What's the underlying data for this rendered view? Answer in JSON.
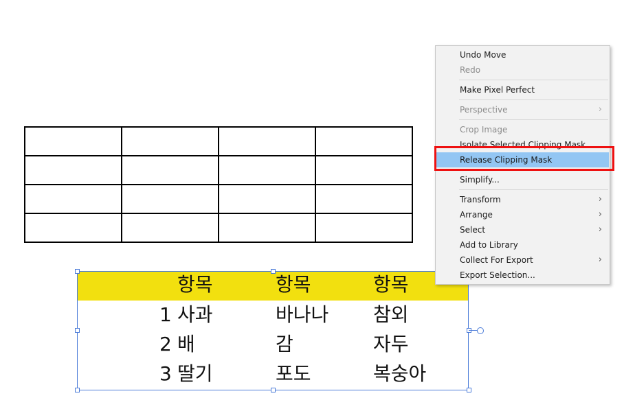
{
  "context_menu": {
    "items": [
      {
        "label": "Undo Move",
        "disabled": false
      },
      {
        "label": "Redo",
        "disabled": true
      },
      {
        "label": "Make Pixel Perfect",
        "disabled": false
      },
      {
        "label": "Perspective",
        "disabled": true,
        "submenu": true
      },
      {
        "label": "Crop Image",
        "disabled": true
      },
      {
        "label": "Isolate Selected Clipping Mask",
        "disabled": false
      },
      {
        "label": "Release Clipping Mask",
        "disabled": false,
        "highlighted": true
      },
      {
        "label": "Simplify...",
        "disabled": false
      },
      {
        "label": "Transform",
        "disabled": false,
        "submenu": true
      },
      {
        "label": "Arrange",
        "disabled": false,
        "submenu": true
      },
      {
        "label": "Select",
        "disabled": false,
        "submenu": true
      },
      {
        "label": "Add to Library",
        "disabled": false
      },
      {
        "label": "Collect For Export",
        "disabled": false,
        "submenu": true
      },
      {
        "label": "Export Selection...",
        "disabled": false
      }
    ],
    "submenu_glyph": "›",
    "highlight_color": "#93c6f3"
  },
  "text_table": {
    "header_color": "#f2e00f",
    "rows": [
      [
        "",
        "항목",
        "항목",
        "항목"
      ],
      [
        "1",
        "사과",
        "바나나",
        "참외"
      ],
      [
        "2",
        "배",
        "감",
        "자두"
      ],
      [
        "3",
        "딸기",
        "포도",
        "복숭아"
      ]
    ]
  },
  "empty_grid": {
    "rows": 4,
    "cols": 4
  },
  "annotation": {
    "color": "#ee1111"
  }
}
